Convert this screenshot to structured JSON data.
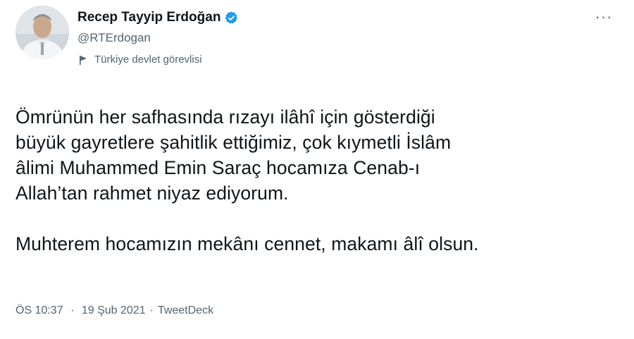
{
  "author": {
    "display_name": "Recep Tayyip Erdoğan",
    "handle": "@RTErdogan",
    "label": "Türkiye devlet görevlisi",
    "verified_color": "#1d9bf0"
  },
  "more_label": "···",
  "tweet": {
    "paragraph_1": [
      "Ömrünün her safhasında rızayı ilâhî için gösterdiği",
      "büyük gayretlere şahitlik ettiğimiz, çok kıymetli İslâm",
      "âlimi Muhammed Emin Saraç hocamıza Cenab-ı",
      "Allah’tan rahmet niyaz ediyorum."
    ],
    "paragraph_2": "Muhterem hocamızın mekânı cennet, makamı âlî olsun."
  },
  "meta": {
    "time": "ÖS 10:37",
    "separator": "·",
    "date": "19 Şub 2021",
    "source": "TweetDeck"
  },
  "icons": {
    "verified": "verified-badge-icon",
    "label": "flag-icon",
    "more": "more-icon"
  }
}
